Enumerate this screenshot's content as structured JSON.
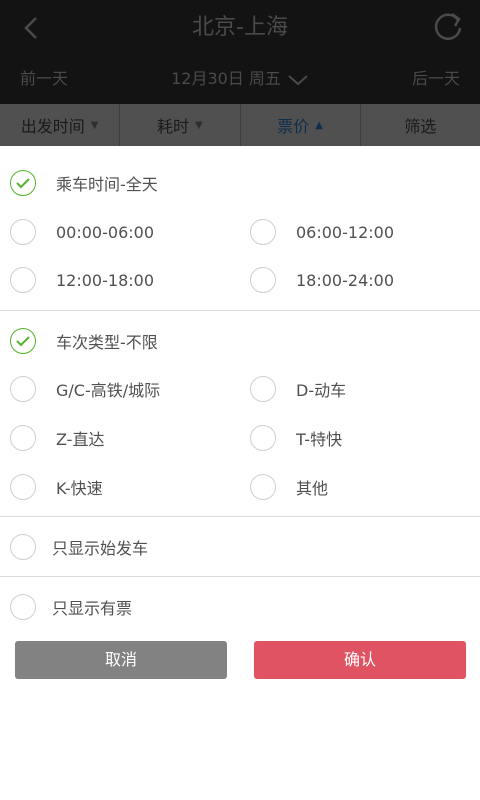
{
  "header": {
    "title": "北京-上海",
    "prev_day": "前一天",
    "current_date": "12月30日 周五",
    "next_day": "后一天"
  },
  "sort_tabs": [
    {
      "label": "出发时间",
      "arrow": "▼"
    },
    {
      "label": "耗时",
      "arrow": "▼"
    },
    {
      "label": "票价",
      "arrow": "▲"
    },
    {
      "label": "筛选",
      "arrow": ""
    }
  ],
  "filters": {
    "time": {
      "title": "乘车时间-全天",
      "options": [
        "00:00-06:00",
        "06:00-12:00",
        "12:00-18:00",
        "18:00-24:00"
      ]
    },
    "train_type": {
      "title": "车次类型-不限",
      "options": [
        "G/C-高铁/城际",
        "D-动车",
        "Z-直达",
        "T-特快",
        "K-快速",
        "其他"
      ]
    },
    "only_origin": "只显示始发车",
    "only_available": "只显示有票"
  },
  "buttons": {
    "cancel": "取消",
    "confirm": "确认"
  },
  "colors": {
    "accent_green": "#56b22c",
    "confirm_red": "#e05363",
    "cancel_gray": "#828282"
  }
}
